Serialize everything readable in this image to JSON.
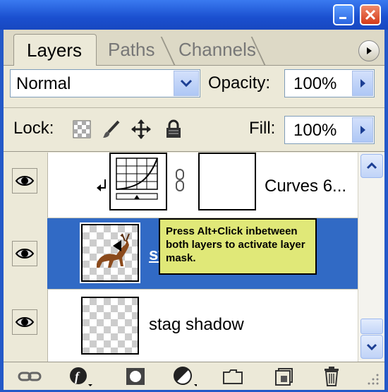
{
  "window": {
    "buttons": [
      "minimize",
      "close"
    ]
  },
  "tabs": [
    {
      "label": "Layers",
      "active": true
    },
    {
      "label": "Paths",
      "active": false
    },
    {
      "label": "Channels",
      "active": false
    }
  ],
  "blend": {
    "mode": "Normal",
    "opacity_label": "Opacity:",
    "opacity_value": "100%"
  },
  "lock": {
    "label": "Lock:",
    "icons": [
      "lock-transparency-icon",
      "lock-paint-icon",
      "lock-position-icon",
      "lock-all-icon"
    ],
    "fill_label": "Fill:",
    "fill_value": "100%"
  },
  "layers": [
    {
      "name": "Curves 6...",
      "type": "adjustment",
      "visible": true,
      "selected": false,
      "clipped": true
    },
    {
      "name": "stag",
      "type": "pixel",
      "visible": true,
      "selected": true
    },
    {
      "name": "stag shadow",
      "type": "pixel",
      "visible": true,
      "selected": false
    }
  ],
  "tooltip": {
    "text": "Press Alt+Click inbetween both layers to activate layer mask."
  },
  "bottom_toolbar": [
    "link-layers-icon",
    "layer-style-icon",
    "layer-mask-icon",
    "adjustment-layer-icon",
    "new-group-icon",
    "new-layer-icon",
    "trash-icon"
  ],
  "colors": {
    "selection": "#316ac5",
    "tooltip_bg": "#e0e878",
    "window_frame": "#2459c8"
  }
}
